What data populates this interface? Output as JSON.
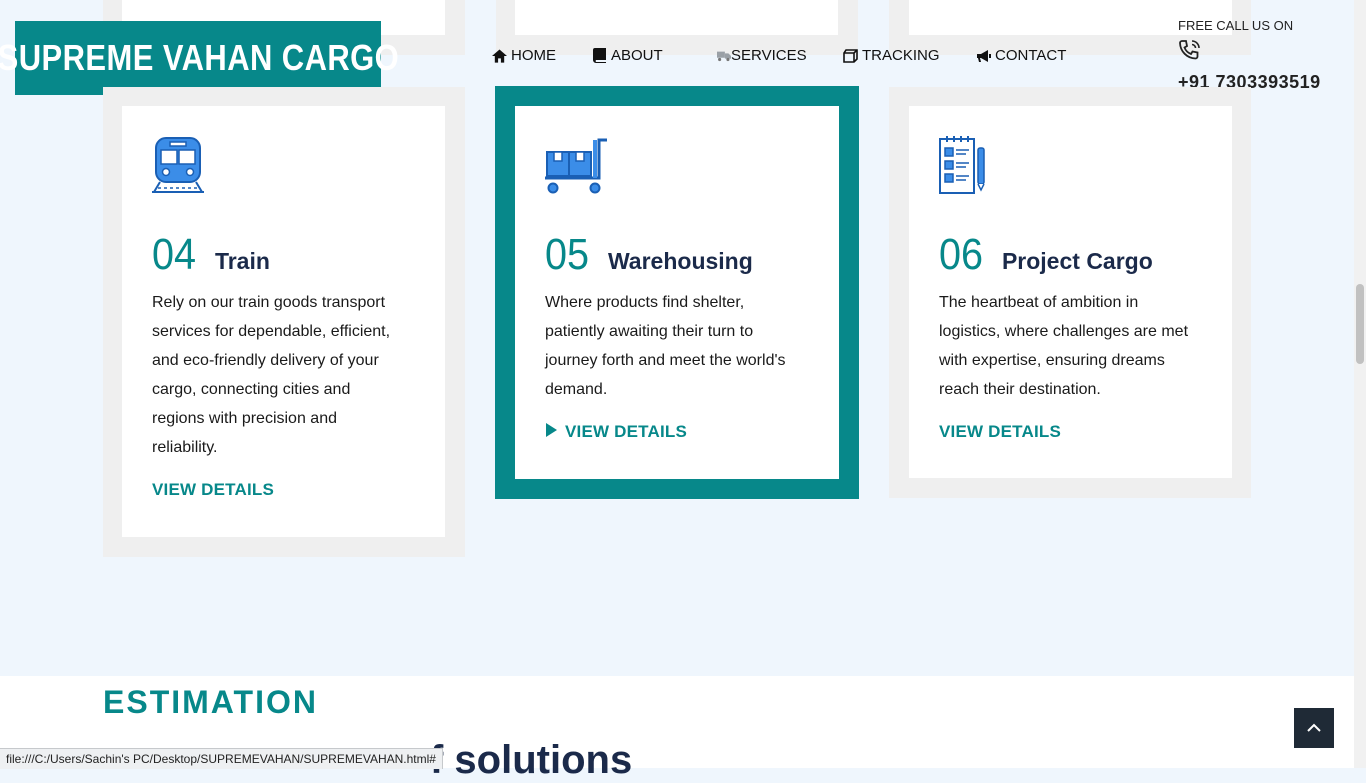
{
  "brand": {
    "logo_text": "SUPREME VAHAN CARGO",
    "accent": "#07888a"
  },
  "nav": [
    {
      "label": "HOME",
      "icon": "home-icon"
    },
    {
      "label": "ABOUT",
      "icon": "book-icon"
    },
    {
      "label": "SERVICES",
      "icon": "truck-icon"
    },
    {
      "label": "TRACKING",
      "icon": "box-icon"
    },
    {
      "label": "CONTACT",
      "icon": "megaphone-icon"
    }
  ],
  "call": {
    "label": "FREE CALL US ON",
    "icon": "phone-icon",
    "number": "+91 7303393519"
  },
  "services": [
    {
      "num": "04",
      "title": "Train",
      "icon": "train-icon",
      "desc": "Rely on our train goods transport services for dependable, efficient, and eco-friendly delivery of your cargo, connecting cities and regions with precision and reliability.",
      "link": "VIEW DETAILS",
      "active": false
    },
    {
      "num": "05",
      "title": "Warehousing",
      "icon": "warehouse-trolley-icon",
      "desc": "Where products find shelter, patiently awaiting their turn to journey forth and meet the world's demand.",
      "link": "VIEW DETAILS",
      "active": true
    },
    {
      "num": "06",
      "title": "Project Cargo",
      "icon": "checklist-icon",
      "desc": "The heartbeat of ambition in logistics, where challenges are met with expertise, ensuring dreams reach their destination.",
      "link": "VIEW DETAILS",
      "active": false
    }
  ],
  "estimation": {
    "label": "ESTIMATION",
    "heading_partial": "f solutions"
  },
  "status_url": "file:///C:/Users/Sachin's PC/Desktop/SUPREMEVAHAN/SUPREMEVAHAN.html#",
  "back_to_top_icon": "chevron-up-icon"
}
